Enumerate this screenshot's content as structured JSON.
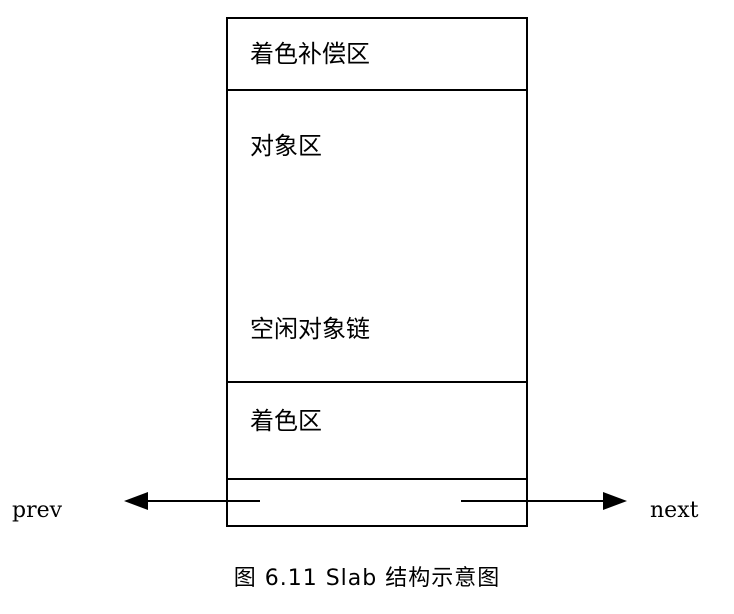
{
  "regions": {
    "coloring_compensation": "着色补偿区",
    "object_area": "对象区",
    "free_object_chain": "空闲对象链",
    "coloring_area": "着色区"
  },
  "pointers": {
    "prev": "prev",
    "next": "next"
  },
  "caption": "图 6.11  Slab 结构示意图"
}
